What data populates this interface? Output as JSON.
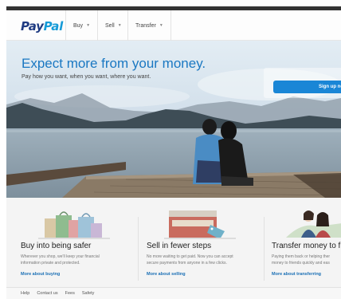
{
  "header": {
    "logo_pay": "Pay",
    "logo_pal": "Pal",
    "nav": [
      {
        "label": "Buy"
      },
      {
        "label": "Sell"
      },
      {
        "label": "Transfer"
      }
    ]
  },
  "hero": {
    "title": "Expect more from your money.",
    "subtitle": "Pay how you want, when you want, where you want.",
    "signup_label": "Sign up no"
  },
  "features": [
    {
      "title": "Buy into being safer",
      "desc1": "Wherever you shop, we'll keep your financial",
      "desc2": "information private and protected.",
      "link": "More about buying"
    },
    {
      "title": "Sell in fewer steps",
      "desc1": "No more waiting to get paid. Now you can accept",
      "desc2": "secure payments from anyone in a few clicks.",
      "link": "More about selling"
    },
    {
      "title": "Transfer money to f",
      "desc1": "Paying them back or helping ther",
      "desc2": "money to friends quickly and eas",
      "link": "More about transferring"
    }
  ],
  "footer": {
    "links": [
      "Help",
      "Contact us",
      "Fees",
      "Safety"
    ]
  },
  "colors": {
    "brand_dark": "#1f3b82",
    "brand_light": "#169bd7",
    "hero_title": "#1a78c2",
    "button": "#1a86d6",
    "link": "#1a6fb5"
  }
}
